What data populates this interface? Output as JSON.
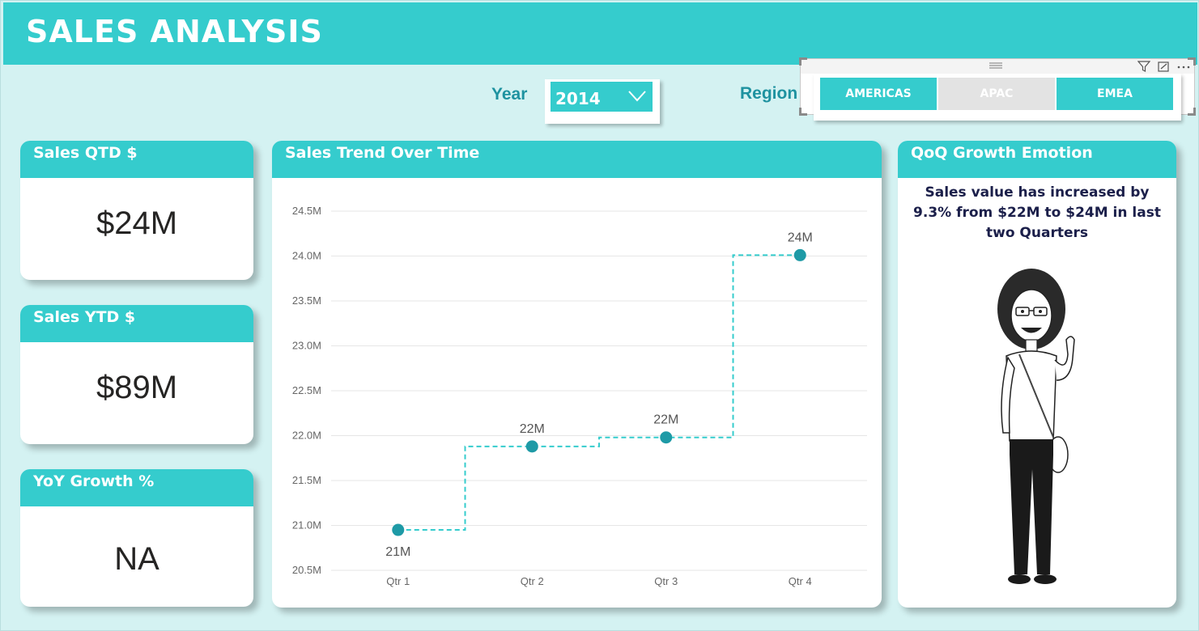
{
  "header": {
    "title": "SALES ANALYSIS"
  },
  "filters": {
    "year_label": "Year",
    "year_value": "2014",
    "region_label": "Region",
    "regions": [
      {
        "label": "AMERICAS",
        "selected": true
      },
      {
        "label": "APAC",
        "selected": false
      },
      {
        "label": "EMEA",
        "selected": true
      }
    ],
    "icons": [
      "drag-handle-icon",
      "filter-icon",
      "focus-mode-icon",
      "more-options-icon"
    ]
  },
  "kpis": {
    "qtd": {
      "title": "Sales QTD $",
      "value": "$24M"
    },
    "ytd": {
      "title": "Sales YTD $",
      "value": "$89M"
    },
    "yoy": {
      "title": "YoY Growth %",
      "value": "NA"
    }
  },
  "trend": {
    "title": "Sales Trend Over Time"
  },
  "emotion": {
    "title": "QoQ Growth Emotion",
    "message": "Sales value has increased by 9.3% from $22M to $24M in last two Quarters"
  },
  "colors": {
    "accent": "#35cccd",
    "point": "#1e9aa6",
    "background": "#d4f2f2"
  },
  "chart_data": {
    "type": "line",
    "title": "Sales Trend Over Time",
    "categories": [
      "Qtr 1",
      "Qtr 2",
      "Qtr 3",
      "Qtr 4"
    ],
    "series": [
      {
        "values": [
          20.95,
          21.88,
          21.98,
          24.01
        ]
      }
    ],
    "data_labels": [
      "21M",
      "22M",
      "22M",
      "24M"
    ],
    "y_ticks": [
      "20.5M",
      "21.0M",
      "21.5M",
      "22.0M",
      "22.5M",
      "23.0M",
      "23.5M",
      "24.0M",
      "24.5M"
    ],
    "ylim": [
      20.5,
      24.5
    ],
    "line_style": "dashed step",
    "grid": true
  }
}
